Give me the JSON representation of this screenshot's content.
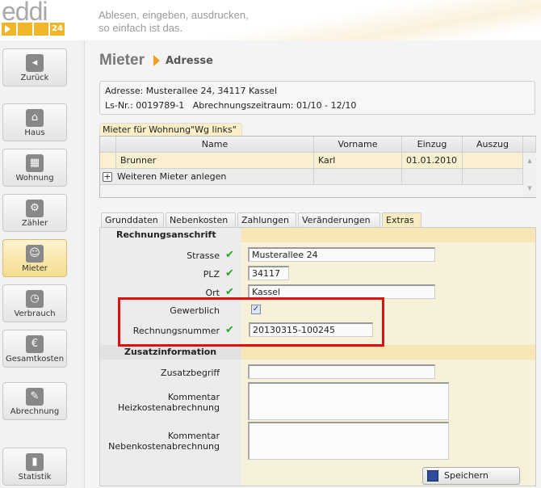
{
  "header": {
    "logo": "eddi",
    "logo_badge": "24",
    "tagline_line1": "Ablesen, eingeben, ausdrucken,",
    "tagline_line2": "so einfach ist das."
  },
  "sidebar": {
    "items": [
      {
        "label": "Zurück",
        "icon": "back-icon"
      },
      {
        "label": "Haus",
        "icon": "house-icon"
      },
      {
        "label": "Wohnung",
        "icon": "apartment-icon"
      },
      {
        "label": "Zähler",
        "icon": "meter-icon"
      },
      {
        "label": "Mieter",
        "icon": "tenant-icon"
      },
      {
        "label": "Verbrauch",
        "icon": "consumption-icon"
      },
      {
        "label": "Gesamtkosten",
        "icon": "euro-icon"
      },
      {
        "label": "Abrechnung",
        "icon": "billing-icon"
      },
      {
        "label": "Statistik",
        "icon": "statistics-icon"
      }
    ]
  },
  "page": {
    "title": "Mieter",
    "subtitle": "Adresse"
  },
  "info": {
    "address": "Adresse: Musterallee 24, 34117 Kassel",
    "line2": "Ls-Nr.: 0019789-1   Abrechnungszeitraum: 01/10 - 12/10"
  },
  "tenants": {
    "tab_label": "Mieter für Wohnung\"Wg links\"",
    "columns": [
      "Name",
      "Vorname",
      "Einzug",
      "Auszug"
    ],
    "rows": [
      {
        "name": "Brunner",
        "vorname": "Karl",
        "einzug": "01.01.2010",
        "auszug": ""
      }
    ],
    "add_label": "Weiteren Mieter anlegen"
  },
  "tabs": [
    "Grunddaten",
    "Nebenkosten",
    "Zahlungen",
    "Veränderungen",
    "Extras"
  ],
  "form": {
    "section1": "Rechnungsanschrift",
    "strasse_label": "Strasse",
    "strasse": "Musterallee 24",
    "plz_label": "PLZ",
    "plz": "34117",
    "ort_label": "Ort",
    "ort": "Kassel",
    "gewerblich_label": "Gewerblich",
    "gewerblich": true,
    "rechnungsnummer_label": "Rechnungsnummer",
    "rechnungsnummer": "20130315-100245",
    "section2": "Zusatzinformation",
    "zusatzbegriff_label": "Zusatzbegriff",
    "zusatzbegriff": "",
    "kommentar_heiz_label1": "Kommentar",
    "kommentar_heiz_label2": "Heizkostenabrechnung",
    "kommentar_neben_label1": "Kommentar",
    "kommentar_neben_label2": "Nebenkostenabrechnung",
    "save_label": "Speichern"
  }
}
